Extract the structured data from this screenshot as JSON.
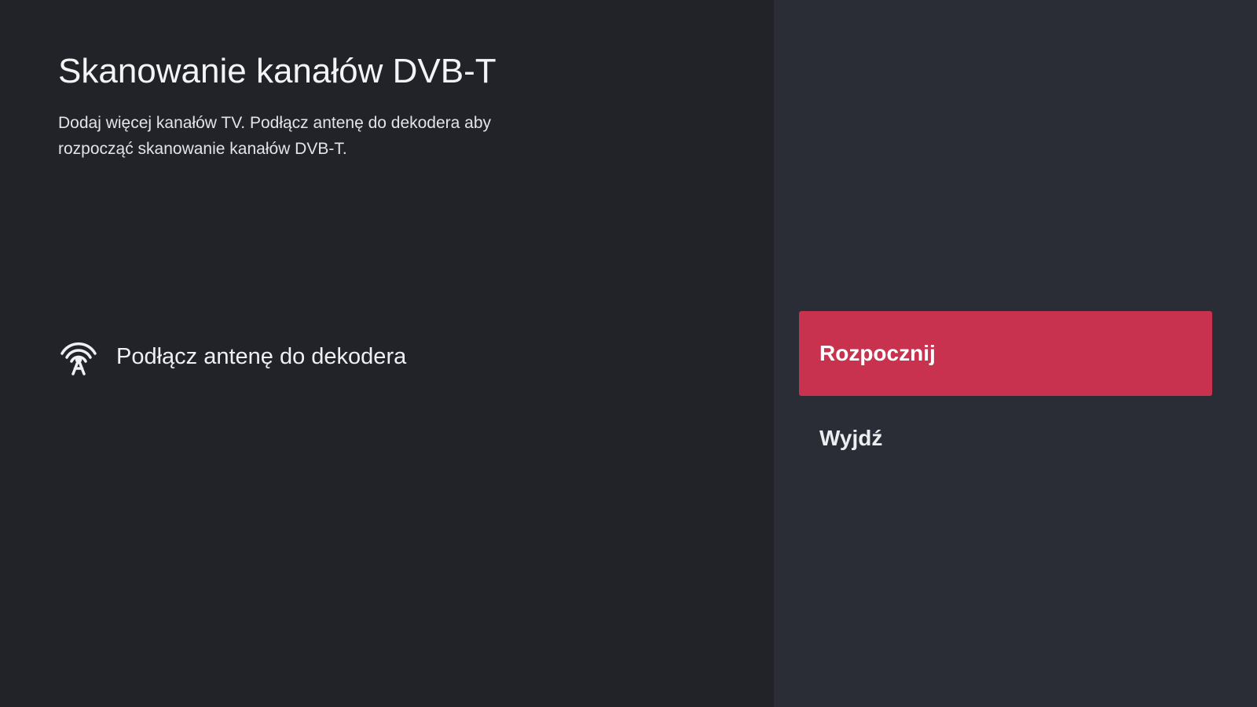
{
  "screen": {
    "title": "Skanowanie kanałów DVB-T",
    "description": "Dodaj więcej kanałów TV. Podłącz antenę do dekodera aby rozpocząć skanowanie kanałów DVB-T."
  },
  "antenna": {
    "icon": "antenna-signal-icon",
    "label": "Podłącz antenę do dekodera"
  },
  "actions": {
    "start_label": "Rozpocznij",
    "exit_label": "Wyjdź",
    "focused": "start"
  },
  "colors": {
    "left_background": "#212328",
    "right_background": "#2a2d35",
    "focus_accent": "#c9324e",
    "text": "#eceef1"
  }
}
